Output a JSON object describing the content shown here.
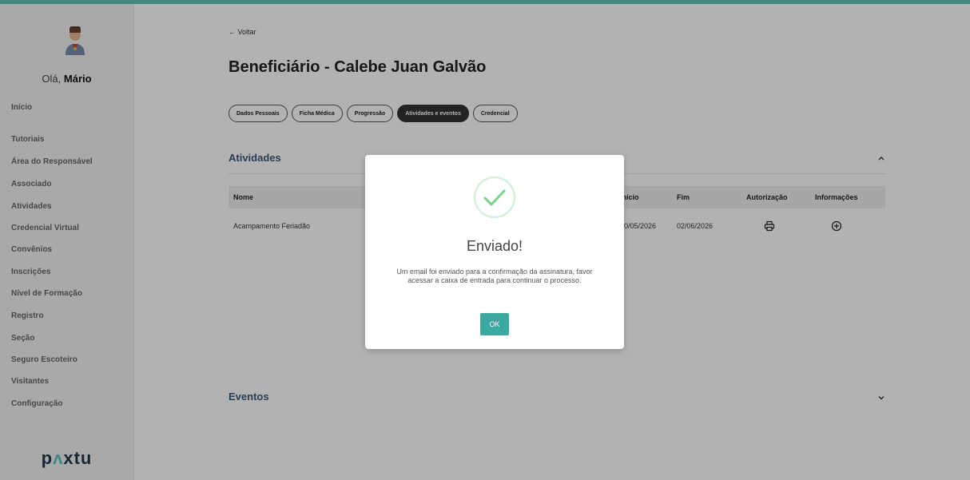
{
  "sidebar": {
    "greeting_prefix": "Olá, ",
    "user_name": "Mário",
    "items": [
      {
        "label": "Início"
      },
      {
        "label": "Tutoriais"
      },
      {
        "label": "Área do Responsável"
      },
      {
        "label": "Associado"
      },
      {
        "label": "Atividades"
      },
      {
        "label": "Credencial Virtual"
      },
      {
        "label": "Convênios"
      },
      {
        "label": "Inscrições"
      },
      {
        "label": "Nível de Formação"
      },
      {
        "label": "Registro"
      },
      {
        "label": "Seção"
      },
      {
        "label": "Seguro Escoteiro"
      },
      {
        "label": "Visitantes"
      },
      {
        "label": "Configuração"
      }
    ],
    "logo_text": {
      "p": "p",
      "a": "ʌ",
      "rest": "xtu"
    }
  },
  "main": {
    "back_label": "← Voltar",
    "title": "Beneficiário - Calebe Juan Galvão",
    "tabs": [
      {
        "label": "Dados Pessoais",
        "active": false
      },
      {
        "label": "Ficha Médica",
        "active": false
      },
      {
        "label": "Progressão",
        "active": false
      },
      {
        "label": "Atividades e eventos",
        "active": true
      },
      {
        "label": "Credencial",
        "active": false
      }
    ],
    "activities": {
      "title": "Atividades",
      "columns": {
        "name": "Nome",
        "start": "Início",
        "end": "Fim",
        "authorization": "Autorização",
        "info": "Informações"
      },
      "rows": [
        {
          "name": "Acampamento Feriadão",
          "start": "30/05/2026",
          "end": "02/06/2026"
        }
      ]
    },
    "events": {
      "title": "Eventos"
    }
  },
  "modal": {
    "title": "Enviado!",
    "message": "Um email foi enviado para a confirmação da assinatura, favor acessar a caixa de entrada para continuar o processo.",
    "ok_label": "OK"
  },
  "colors": {
    "accent": "#5cc4b8",
    "ok_button": "#3aa99f",
    "section_title": "#3a5a7a",
    "check_green": "#7ad28b"
  },
  "icons": {
    "authorization": "printer-icon",
    "info": "plus-circle-icon",
    "activities_toggle": "chevron-up-icon",
    "events_toggle": "chevron-down-icon"
  }
}
